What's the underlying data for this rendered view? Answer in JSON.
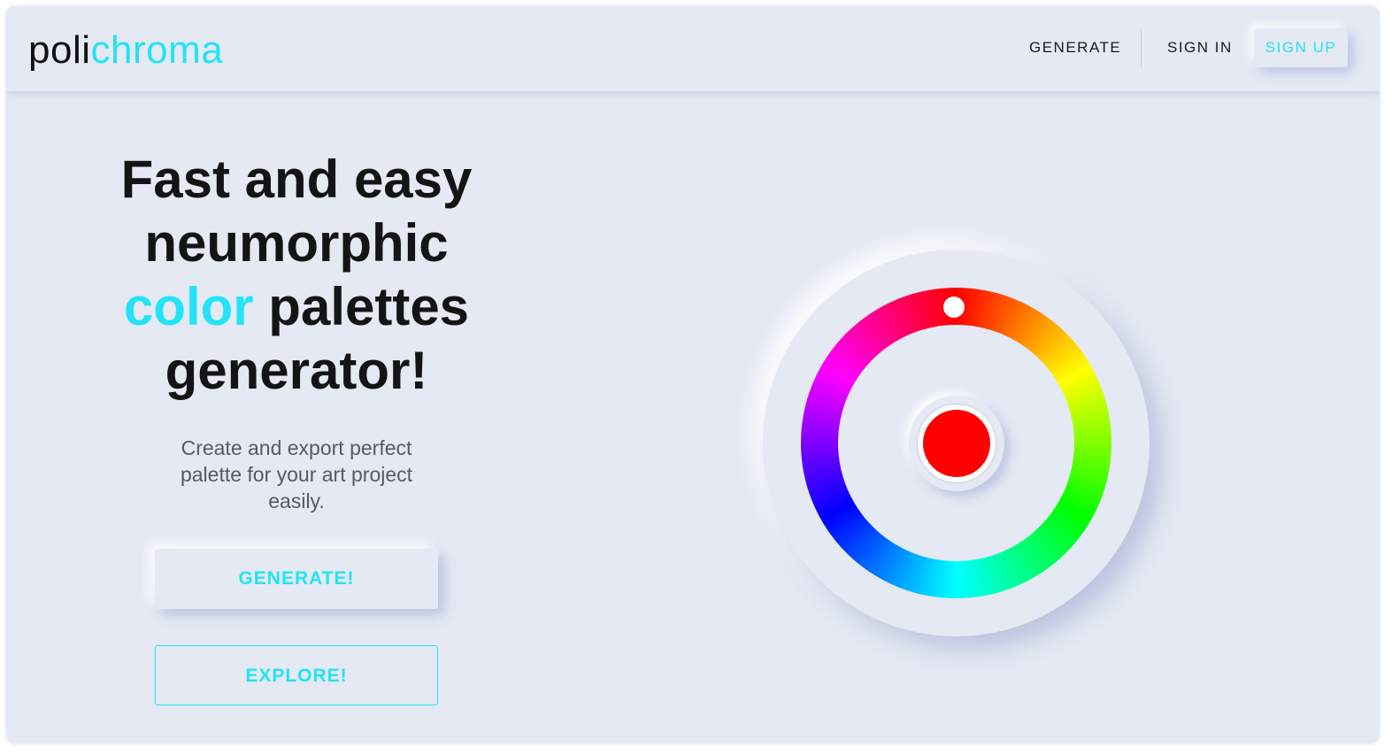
{
  "brand": {
    "logo_part1": "poli",
    "logo_part2": "chroma"
  },
  "nav": {
    "generate_label": "GENERATE",
    "signin_label": "SIGN IN",
    "signup_label": "SIGN UP"
  },
  "hero": {
    "headline_line1": "Fast and easy",
    "headline_line2": "neumorphic",
    "headline_accent": "color",
    "headline_line3_rest": " palettes",
    "headline_line4": "generator!",
    "subtitle": "Create and export perfect palette for your art project easily.",
    "generate_button": "GENERATE!",
    "explore_button": "EXPLORE!"
  },
  "color_picker": {
    "selected_color": "#ff0000",
    "handle_icon": "wheel-handle-icon"
  },
  "colors": {
    "accent": "#22e3f7",
    "background": "#e4e9f4",
    "text_primary": "#141414"
  }
}
